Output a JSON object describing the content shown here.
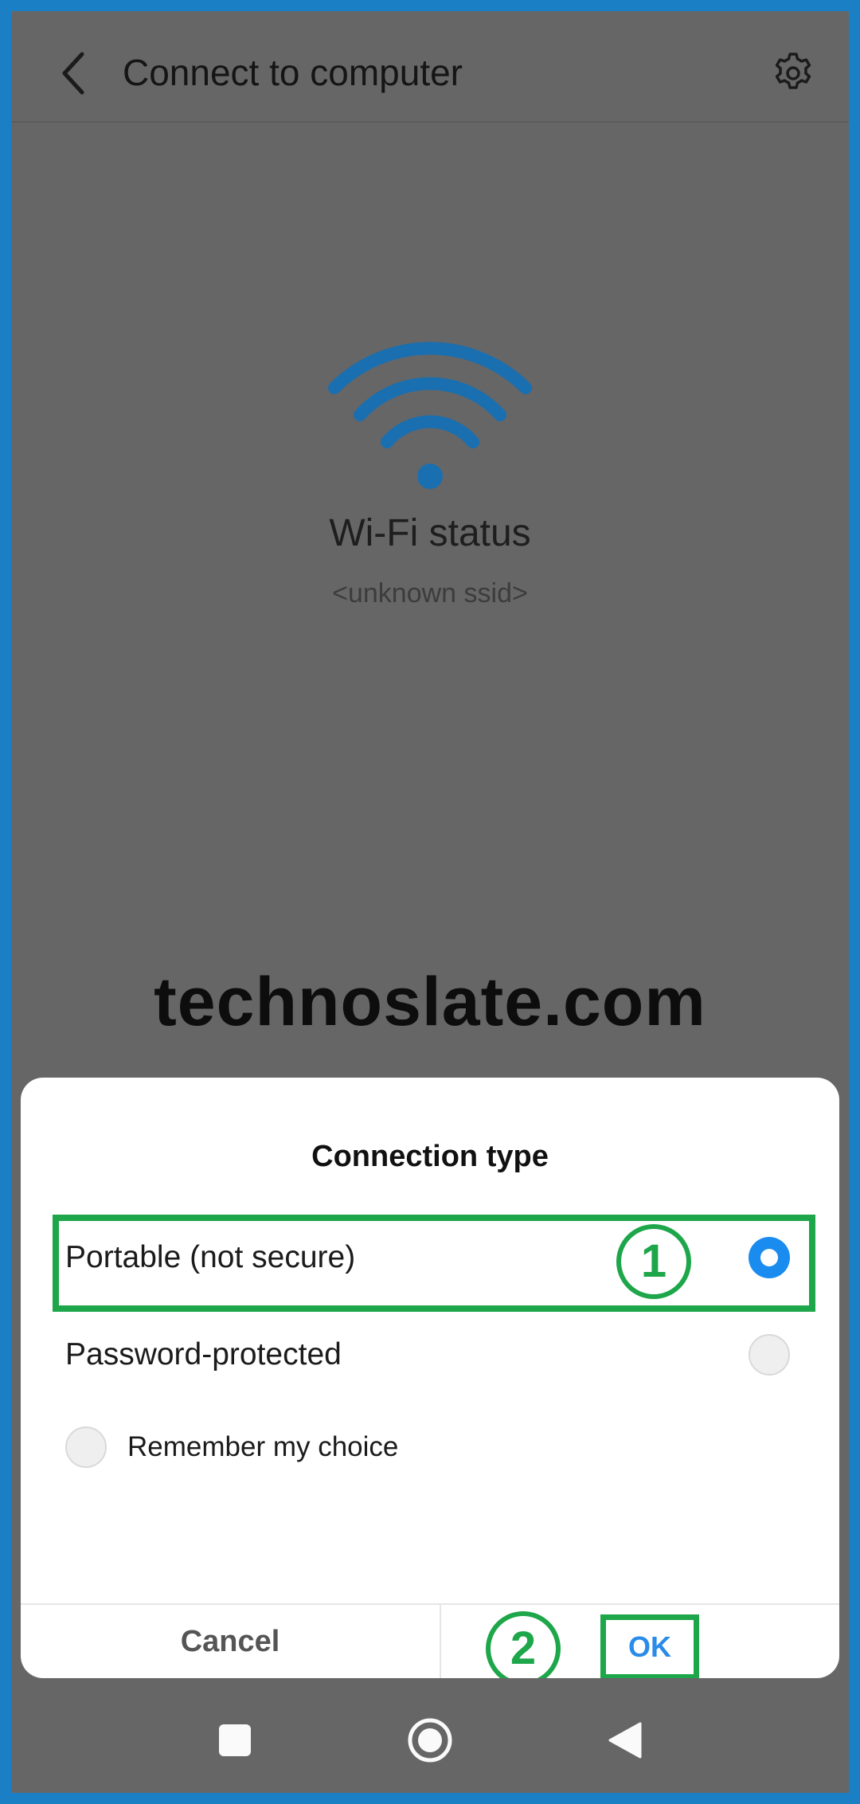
{
  "header": {
    "title": "Connect to computer",
    "back_icon": "back-arrow-icon",
    "settings_icon": "gear-icon"
  },
  "wifi": {
    "icon": "wifi-icon",
    "icon_color": "#1a6fb0",
    "status_label": "Wi-Fi status",
    "ssid": "<unknown ssid>"
  },
  "watermark": "technoslate.com",
  "dialog": {
    "title": "Connection type",
    "options": [
      {
        "label": "Portable (not secure)",
        "selected": true
      },
      {
        "label": "Password-protected",
        "selected": false
      }
    ],
    "remember": {
      "label": "Remember my choice",
      "checked": false
    },
    "cancel_label": "Cancel",
    "ok_label": "OK",
    "accent_color": "#1a8cf0"
  },
  "annotations": {
    "step1": "1",
    "step2": "2",
    "highlight_color": "#1ea64a"
  },
  "navbar": {
    "recents_icon": "square-icon",
    "home_icon": "circle-home-icon",
    "back_icon": "triangle-back-icon"
  }
}
